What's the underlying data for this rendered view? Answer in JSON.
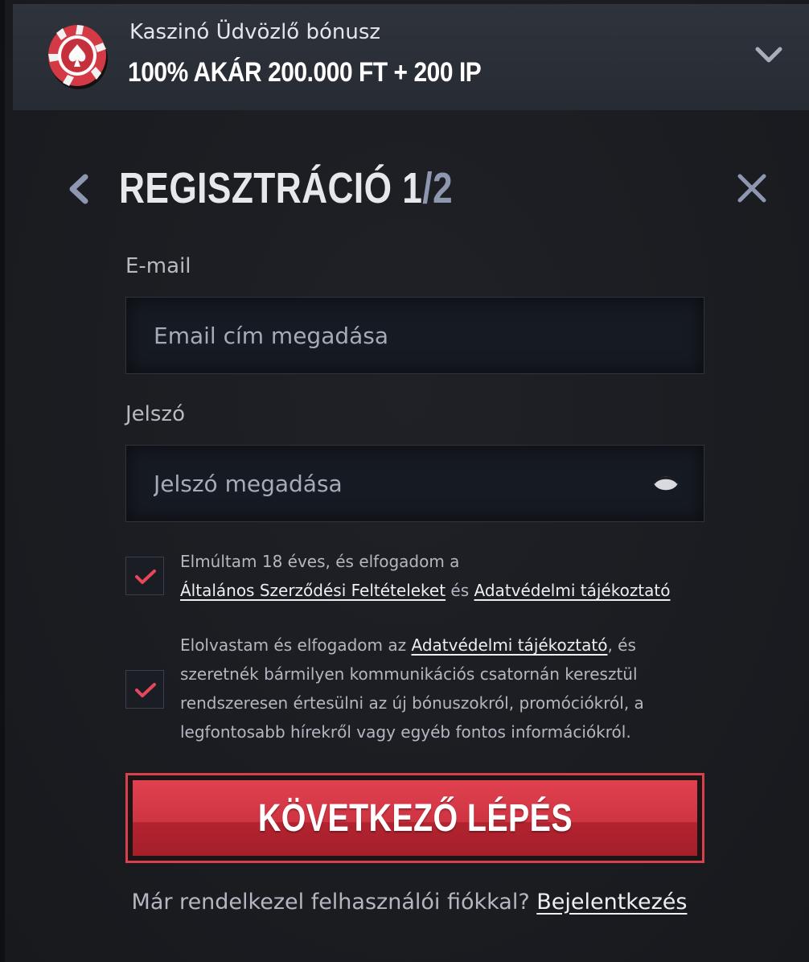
{
  "banner": {
    "subtitle": "Kaszinó Üdvözlő bónusz",
    "title": "100% AKÁR 200.000 FT + 200 IP",
    "icon": "poker-chip-icon",
    "chip_color": "#d33a45"
  },
  "header": {
    "title": "REGISZTRÁCIÓ 1",
    "title_sep": "/",
    "step_total": "2"
  },
  "form": {
    "email": {
      "label": "E-mail",
      "placeholder": "Email cím megadása",
      "value": ""
    },
    "password": {
      "label": "Jelszó",
      "placeholder": "Jelszó megadása",
      "value": ""
    },
    "terms": {
      "checked": true,
      "line1": "Elmúltam 18 éves, és elfogadom a",
      "terms_link": "Általános Szerződési Feltételeket",
      "and": " és ",
      "privacy_link": "Adatvédelmi tájékoztató"
    },
    "marketing": {
      "checked": true,
      "pre": "Elolvastam és elfogadom az ",
      "privacy_link": "Adatvédelmi tájékoztató",
      "post1": ", és",
      "line2": "szeretnék bármilyen kommunikációs csatornán keresztül",
      "line3": "rendszeresen értesülni az új bónuszokról, promóciókról, a",
      "line4": "legfontosabb hírekről vagy egyéb fontos információkról."
    },
    "next_button": "KÖVETKEZŐ LÉPÉS"
  },
  "footer": {
    "question": "Már rendelkezel felhasználói fiókkal? ",
    "login_link": "Bejelentkezés"
  },
  "colors": {
    "accent": "#d33a45",
    "check": "#e8475b",
    "background": "#1b1d22",
    "banner": "#2c3039"
  }
}
